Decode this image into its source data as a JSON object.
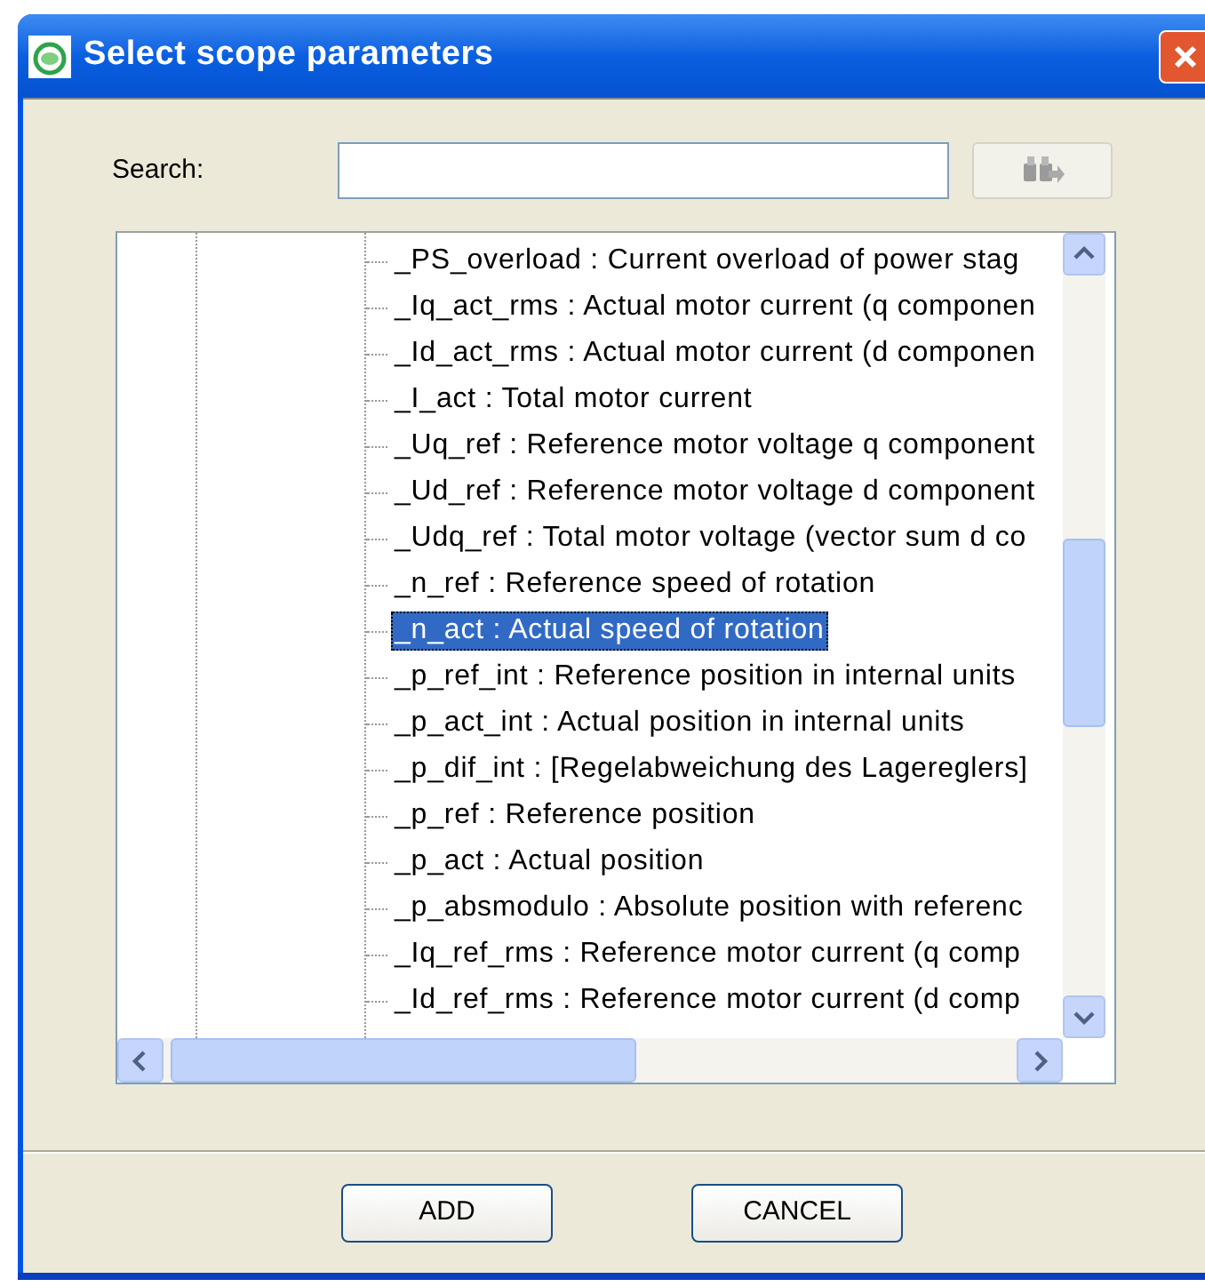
{
  "window": {
    "title": "Select scope parameters"
  },
  "search": {
    "label": "Search:"
  },
  "tree": {
    "items": [
      {
        "label": "_PS_overload : Current overload of power stag",
        "selected": false
      },
      {
        "label": "_Iq_act_rms : Actual motor current (q componen",
        "selected": false
      },
      {
        "label": "_Id_act_rms : Actual motor current (d componen",
        "selected": false
      },
      {
        "label": "_I_act : Total motor current",
        "selected": false
      },
      {
        "label": "_Uq_ref : Reference motor voltage q component",
        "selected": false
      },
      {
        "label": "_Ud_ref : Reference motor voltage d component",
        "selected": false
      },
      {
        "label": "_Udq_ref : Total motor voltage (vector sum d co",
        "selected": false
      },
      {
        "label": "_n_ref : Reference speed of rotation",
        "selected": false
      },
      {
        "label": "_n_act : Actual speed of rotation",
        "selected": true
      },
      {
        "label": "_p_ref_int : Reference position in internal units",
        "selected": false
      },
      {
        "label": "_p_act_int : Actual position in internal units",
        "selected": false
      },
      {
        "label": "_p_dif_int : [Regelabweichung des Lagereglers]",
        "selected": false
      },
      {
        "label": "_p_ref : Reference position",
        "selected": false
      },
      {
        "label": "_p_act : Actual position",
        "selected": false
      },
      {
        "label": "_p_absmodulo : Absolute position with referenc",
        "selected": false
      },
      {
        "label": "_Iq_ref_rms : Reference motor current (q comp",
        "selected": false
      },
      {
        "label": "_Id_ref_rms : Reference motor current (d comp",
        "selected": false
      }
    ]
  },
  "buttons": [
    "ADD",
    "CANCEL"
  ]
}
